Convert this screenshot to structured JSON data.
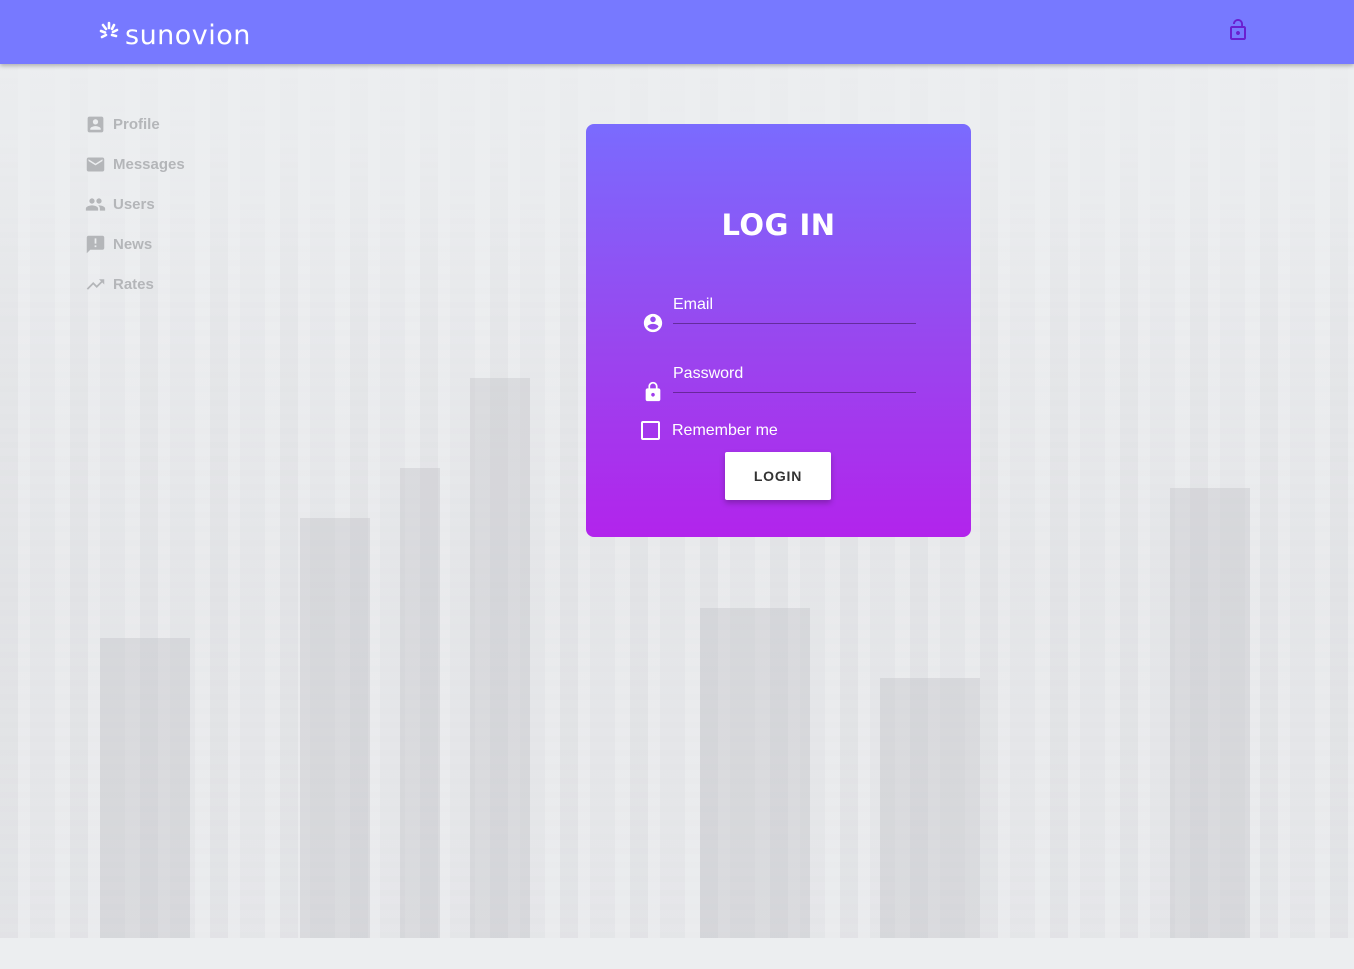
{
  "header": {
    "brand": "sunovion",
    "logo_icon": "sunovion-logo-icon",
    "lock_icon": "lock-open-icon",
    "background_color": "#7779ff",
    "lock_color": "#6a1fd0"
  },
  "sidebar": {
    "items": [
      {
        "label": "Profile",
        "icon": "account-box-icon"
      },
      {
        "label": "Messages",
        "icon": "mail-icon"
      },
      {
        "label": "Users",
        "icon": "people-icon"
      },
      {
        "label": "News",
        "icon": "announcement-icon"
      },
      {
        "label": "Rates",
        "icon": "trending-up-icon"
      }
    ]
  },
  "login": {
    "title": "LOG IN",
    "email_label": "Email",
    "email_value": "",
    "password_label": "Password",
    "password_value": "",
    "remember_label": "Remember me",
    "remember_checked": false,
    "button_label": "LOGIN",
    "gradient_top": "#7a6bfe",
    "gradient_bottom": "#b224ec"
  }
}
